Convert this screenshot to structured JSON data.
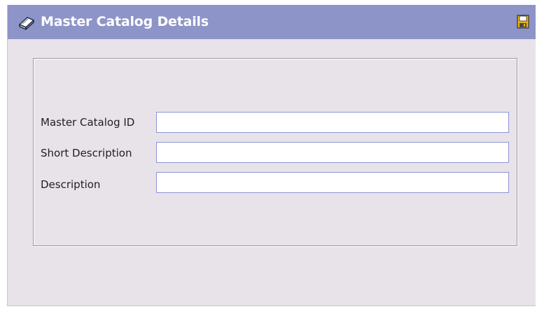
{
  "window": {
    "title": "Master Catalog Details"
  },
  "icons": {
    "title_icon": "catalog-book-icon",
    "save_icon": "save-floppy-icon"
  },
  "form": {
    "fields": [
      {
        "label": "Master Catalog ID",
        "value": "",
        "placeholder": ""
      },
      {
        "label": "Short Description",
        "value": "",
        "placeholder": ""
      },
      {
        "label": "Description",
        "value": "",
        "placeholder": ""
      }
    ]
  },
  "colors": {
    "titlebar": "#8c94c8",
    "panel": "#e8e3e8",
    "input_border": "#8c94d6"
  }
}
